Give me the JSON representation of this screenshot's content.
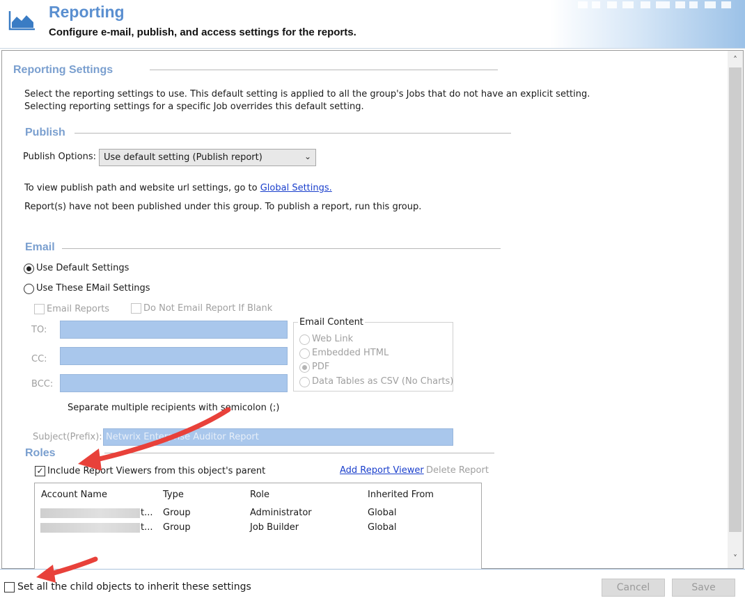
{
  "header": {
    "title": "Reporting",
    "subtitle": "Configure e-mail, publish, and access settings for the reports."
  },
  "reporting_settings": {
    "heading": "Reporting Settings",
    "description_line1": "Select the reporting settings to use. This default setting is applied to all the group's Jobs that do not have an explicit setting.",
    "description_line2": "Selecting reporting settings for a specific Job overrides this default setting."
  },
  "publish": {
    "heading": "Publish",
    "options_label": "Publish Options:",
    "selected_option": "Use default setting (Publish report)",
    "info_prefix": "To view publish path and website url settings, go to ",
    "global_settings_link": "Global Settings.",
    "status_text": "Report(s) have not been published under this group. To publish a report, run this group."
  },
  "email": {
    "heading": "Email",
    "use_default_label": "Use Default Settings",
    "use_default_selected": true,
    "use_these_label": "Use These EMail Settings",
    "email_reports_label": "Email Reports",
    "no_blank_label": "Do Not Email Report If Blank",
    "to_label": "TO:",
    "cc_label": "CC:",
    "bcc_label": "BCC:",
    "separator_hint": "Separate multiple recipients with semicolon (;)",
    "subject_label": "Subject(Prefix):",
    "subject_value": "Netwrix Enterprise Auditor Report",
    "content": {
      "title": "Email Content",
      "options": [
        "Web Link",
        "Embedded HTML",
        "PDF",
        "Data Tables as CSV (No Charts)"
      ],
      "selected": "PDF"
    }
  },
  "roles": {
    "heading": "Roles",
    "include_label": "Include Report Viewers from this object's parent",
    "include_checked": true,
    "add_viewer_link": "Add Report Viewer",
    "delete_link": "Delete Report",
    "columns": [
      "Account Name",
      "Type",
      "Role",
      "Inherited From"
    ],
    "rows": [
      {
        "account_suffix": "t...",
        "type": "Group",
        "role": "Administrator",
        "inherited": "Global"
      },
      {
        "account_suffix": "t...",
        "type": "Group",
        "role": "Job Builder",
        "inherited": "Global"
      }
    ]
  },
  "footer": {
    "inherit_label": "Set all the child objects to inherit these settings",
    "cancel_label": "Cancel",
    "save_label": "Save"
  },
  "icons": {
    "logo": "area-chart-icon",
    "dropdown": "chevron-down-icon",
    "scroll_up": "chevron-up-icon",
    "scroll_down": "chevron-down-icon"
  },
  "colors": {
    "accent": "#5a8fd0",
    "section": "#7a9fcf",
    "field": "#a9c7ec",
    "link": "#1a3fcc",
    "annotation_arrow": "#e8413a"
  }
}
